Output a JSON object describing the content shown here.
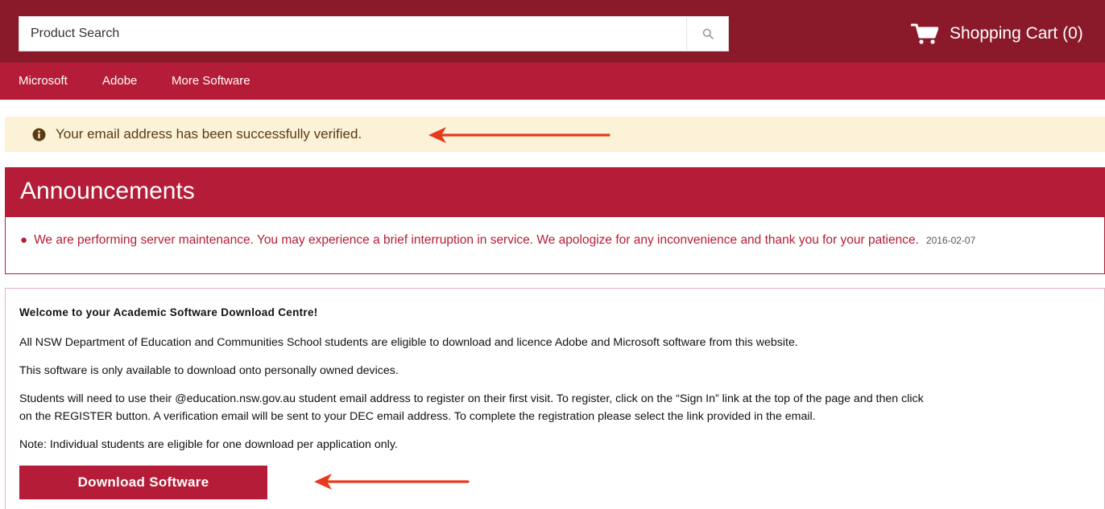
{
  "header": {
    "search_placeholder": "Product Search",
    "cart_label": "Shopping Cart (0)"
  },
  "nav": {
    "items": [
      {
        "label": "Microsoft"
      },
      {
        "label": "Adobe"
      },
      {
        "label": "More Software"
      }
    ]
  },
  "alert": {
    "message": "Your email address has been successfully verified."
  },
  "announcements": {
    "title": "Announcements",
    "items": [
      {
        "text": "We are performing server maintenance. You may experience a brief interruption in service. We apologize for any inconvenience and thank you for your patience.",
        "date": "2016-02-07"
      }
    ]
  },
  "welcome": {
    "title": "Welcome to your Academic Software Download Centre!",
    "paragraphs": [
      "All NSW Department of Education and Communities School students are eligible to download and licence Adobe and Microsoft software from this website.",
      "This software is only available to download onto personally owned devices.",
      "Students will need to use their @education.nsw.gov.au student email address to register on their first visit. To register, click on the “Sign In” link at the top of the page and then click",
      "on the REGISTER button. A verification email will be sent to your DEC email address. To complete the registration please select the link provided in the email.",
      "Note: Individual students are eligible for one download per application only."
    ],
    "download_label": "Download Software"
  },
  "colors": {
    "topbar": "#8a1a2a",
    "brand": "#b51c37",
    "alert_bg": "#fcf2d8",
    "arrow": "#e8391c"
  },
  "icons": {
    "search": "search-icon",
    "cart": "cart-icon",
    "info": "info-icon"
  }
}
